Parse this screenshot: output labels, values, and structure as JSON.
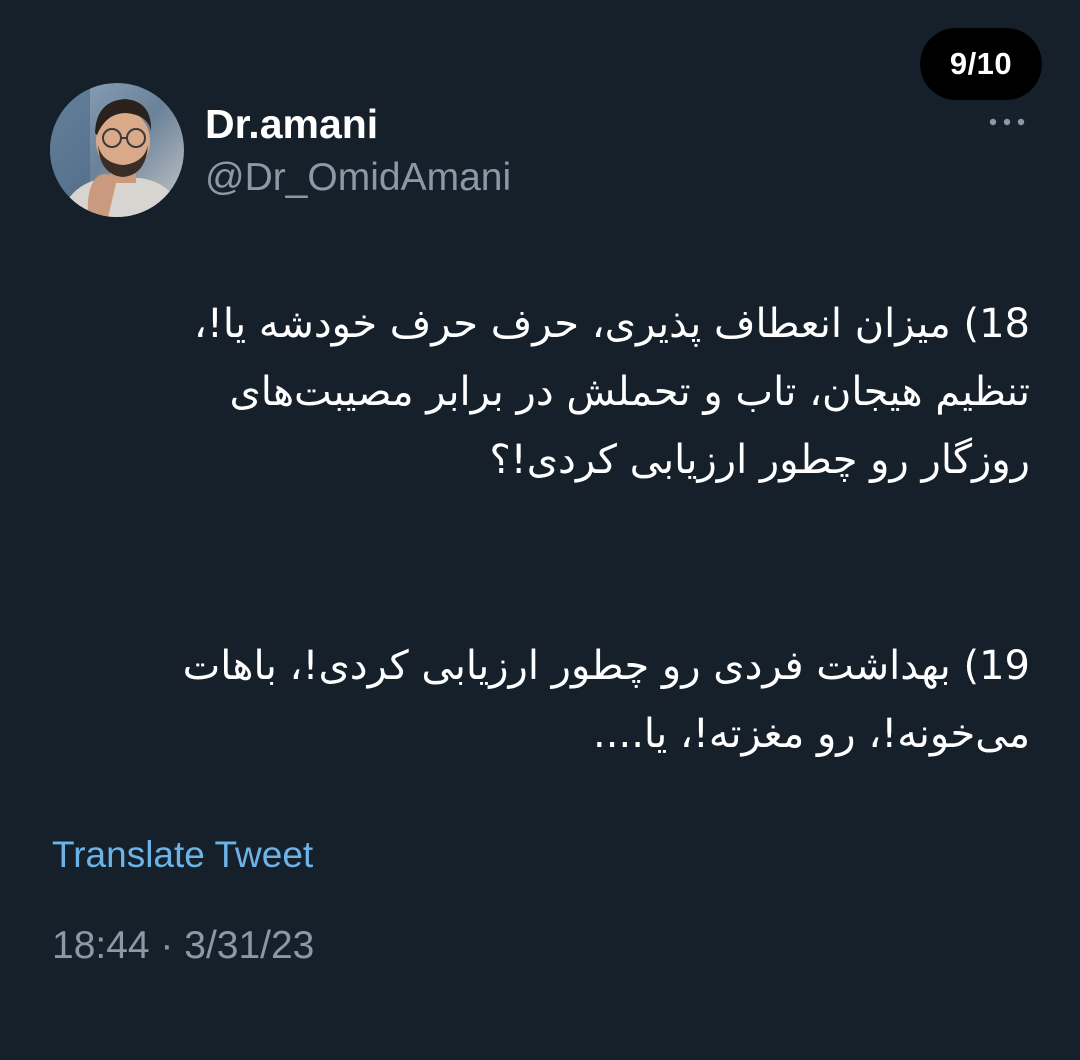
{
  "thread": {
    "counter": "9/10"
  },
  "author": {
    "display_name": "Dr.amani",
    "handle": "@Dr_OmidAmani",
    "avatar_icon": "profile-photo"
  },
  "header": {
    "more_icon": "more-horizontal-icon"
  },
  "tweet": {
    "paragraphs": [
      {
        "lines": [
          "18) میزان انعطاف پذیری، حرف حرف خودشه یا!،",
          "تنظیم هیجان، تاب و تحملش در برابر مصیبت‌های",
          "روزگار رو چطور ارزیابی کردی!؟"
        ]
      },
      {
        "lines": [
          "19) بهداشت فردی رو چطور ارزیابی کردی!، باهات",
          "می‌خونه!، رو مغزته!، یا...."
        ]
      }
    ],
    "translate_label": "Translate Tweet",
    "timestamp": "18:44 · 3/31/23"
  },
  "colors": {
    "background": "#15202b",
    "text_primary": "#ffffff",
    "text_secondary": "#8b98a5",
    "link": "#6cb3e8",
    "counter_bg": "#000000"
  }
}
